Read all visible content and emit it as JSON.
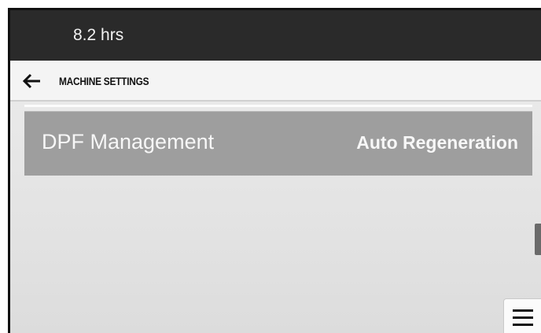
{
  "status_bar": {
    "hours": "8.2 hrs"
  },
  "header": {
    "back_icon": "arrow-left-icon",
    "title": "MACHINE SETTINGS"
  },
  "settings": [
    {
      "label": "DPF Management",
      "value": "Auto Regeneration"
    }
  ],
  "menu": {
    "icon": "hamburger-menu-icon"
  },
  "colors": {
    "top_bar": "#2a2a2a",
    "nav_bar": "#f4f4f4",
    "setting_row": "#9e9e9e",
    "setting_text": "#f7f7f7",
    "content_bg": "#e6e6e6"
  }
}
